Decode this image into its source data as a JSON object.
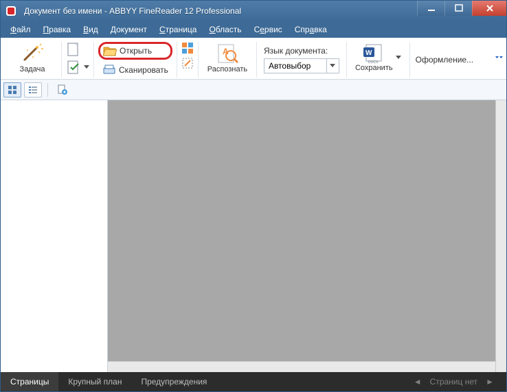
{
  "window": {
    "title": "Документ без имени - ABBYY FineReader 12 Professional"
  },
  "menu": {
    "items": [
      {
        "pre": "",
        "ul": "Ф",
        "post": "айл"
      },
      {
        "pre": "",
        "ul": "П",
        "post": "равка"
      },
      {
        "pre": "",
        "ul": "В",
        "post": "ид"
      },
      {
        "pre": "",
        "ul": "Д",
        "post": "окумент"
      },
      {
        "pre": "",
        "ul": "С",
        "post": "траница"
      },
      {
        "pre": "",
        "ul": "О",
        "post": "бласть"
      },
      {
        "pre": "С",
        "ul": "е",
        "post": "рвис"
      },
      {
        "pre": "Спр",
        "ul": "а",
        "post": "вка"
      }
    ]
  },
  "toolbar": {
    "task": "Задача",
    "open": "Открыть",
    "scan": "Сканировать",
    "recognize": "Распознать",
    "lang_label": "Язык документа:",
    "lang_value": "Автовыбор",
    "save": "Сохранить",
    "format": "Оформление..."
  },
  "bottom": {
    "tabs": [
      "Страницы",
      "Крупный план",
      "Предупреждения"
    ],
    "pages_status": "Страниц нет"
  }
}
